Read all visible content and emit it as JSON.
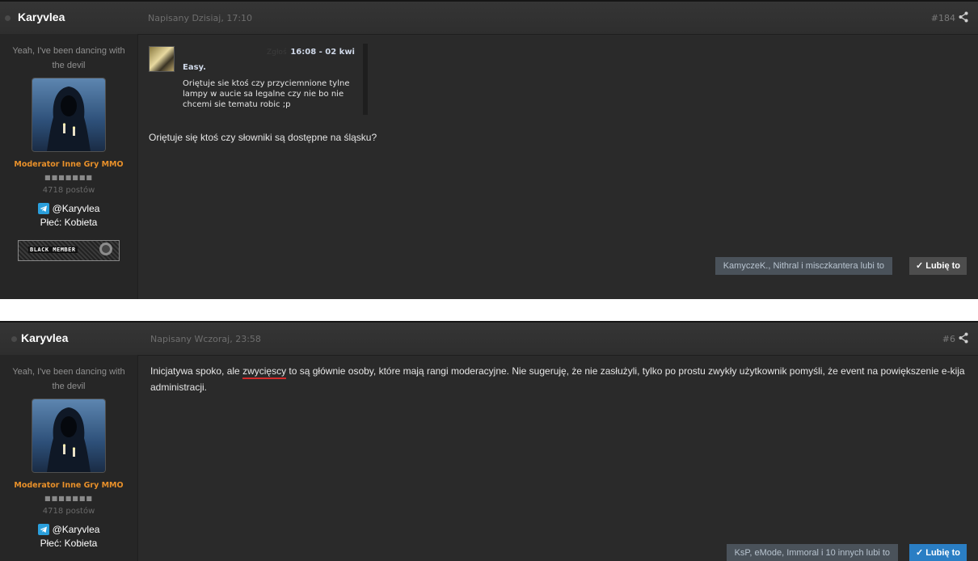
{
  "colors": {
    "role": "#e8902a",
    "like_active": "#2a7ec4",
    "underline": "#d12b2b"
  },
  "posts": [
    {
      "username": "Karyvlea",
      "date": "Napisany Dzisiaj, 17:10",
      "number": "#184",
      "user_quote": "Yeah, I've been dancing with the devil",
      "role": "Moderator Inne Gry MMO",
      "pips": "■■■■■■■",
      "post_count": "4718 postów",
      "telegram": "@Karyvlea",
      "sex": "Płeć: Kobieta",
      "badge": "BLACK MEMBER",
      "quote": {
        "report": "Zgłoś",
        "time": "16:08 - 02 kwi",
        "author": "Easy.",
        "text": "Oriętuje sie ktoś czy przyciemnione tylne lampy w aucie sa legalne czy nie bo nie chcemi sie tematu robic ;p"
      },
      "body": "Oriętuje się ktoś czy słowniki są dostępne na śląsku?",
      "likes_text": "KamyczeK., Nithral i misczkantera lubi to",
      "like_label": "✓ Lubię to"
    },
    {
      "username": "Karyvlea",
      "date": "Napisany Wczoraj, 23:58",
      "number": "#6",
      "user_quote": "Yeah, I've been dancing with the devil",
      "role": "Moderator Inne Gry MMO",
      "pips": "■■■■■■■",
      "post_count": "4718 postów",
      "telegram": "@Karyvlea",
      "sex": "Płeć: Kobieta",
      "body_pre": "Inicjatywa spoko, ale ",
      "body_ul": "zwycięscy",
      "body_post": " to są głównie osoby, które mają rangi moderacyjne. Nie sugeruję, że nie zasłużyli, tylko po prostu zwykły użytkownik pomyśli, że event na powiększenie e-kija administracji.",
      "likes_text": "KsP, eMode, Immoral i 10 innych lubi to",
      "like_label": "✓ Lubię to"
    }
  ]
}
